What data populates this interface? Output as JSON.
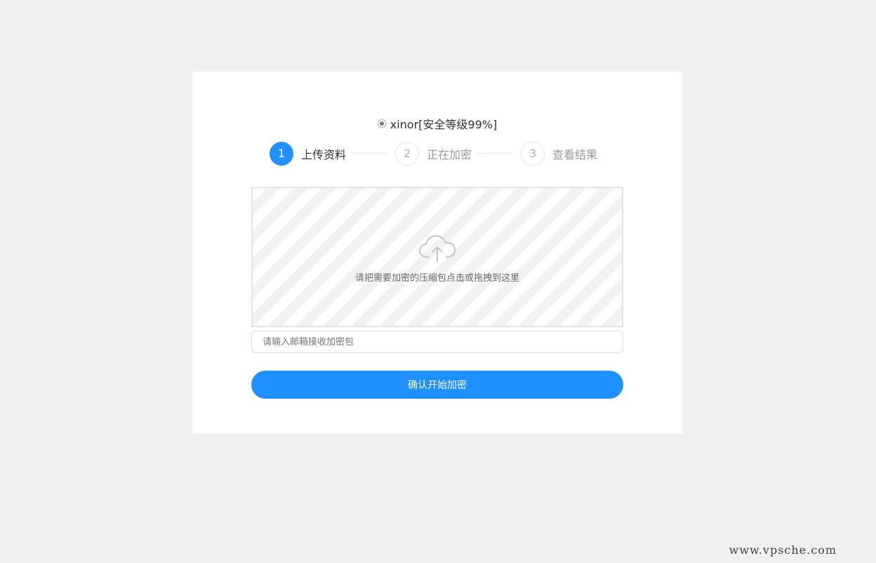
{
  "algorithm": {
    "label": "xinor[安全等级99%]",
    "selected": true
  },
  "steps": [
    {
      "number": "1",
      "label": "上传资料",
      "active": true
    },
    {
      "number": "2",
      "label": "正在加密",
      "active": false
    },
    {
      "number": "3",
      "label": "查看结果",
      "active": false
    }
  ],
  "upload": {
    "icon": "cloud-upload-icon",
    "hint": "请把需要加密的压缩包点击或拖拽到这里"
  },
  "email": {
    "placeholder": "请输入邮箱接收加密包",
    "value": ""
  },
  "confirm_button": {
    "label": "确认开始加密"
  },
  "watermark": "www.vpsche.com",
  "colors": {
    "accent": "#1e90ff",
    "background": "#f0f0f0",
    "card": "#ffffff"
  }
}
